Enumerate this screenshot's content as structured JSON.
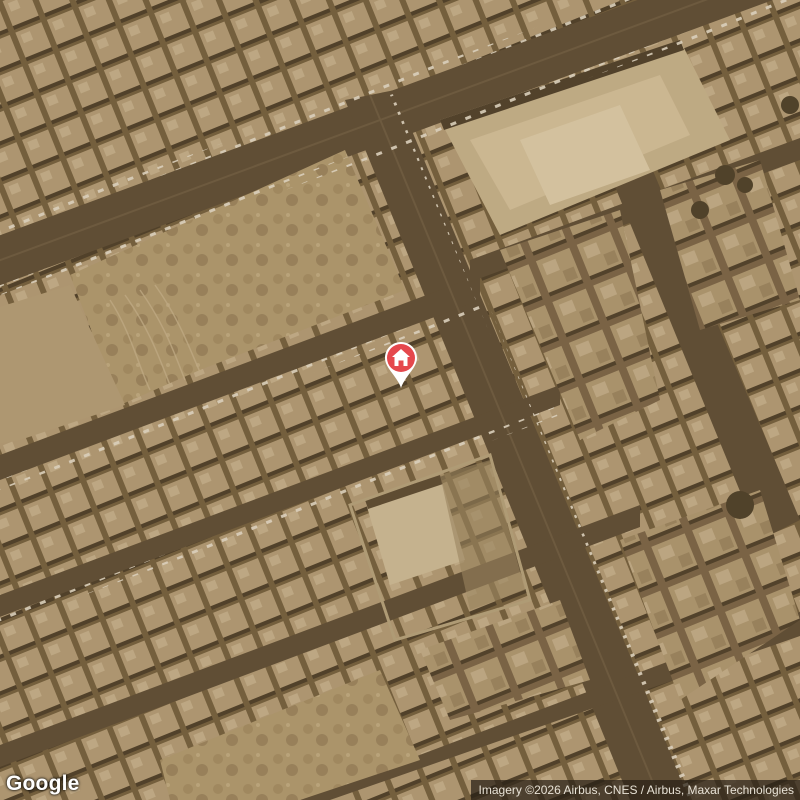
{
  "map": {
    "type": "satellite",
    "tint": "sepia",
    "colors": {
      "ground": "#6e5a3e",
      "road": "#5f4f38",
      "roof": "#b8a480",
      "roof_shadow": "#4a3c29",
      "vacant_lot": "#a8926a",
      "pin": "#e5484d"
    }
  },
  "marker": {
    "icon": "home-icon",
    "color": "#e5484d"
  },
  "logo": {
    "text": "Google"
  },
  "attribution": {
    "text": "Imagery ©2026 Airbus, CNES / Airbus, Maxar Technologies"
  }
}
